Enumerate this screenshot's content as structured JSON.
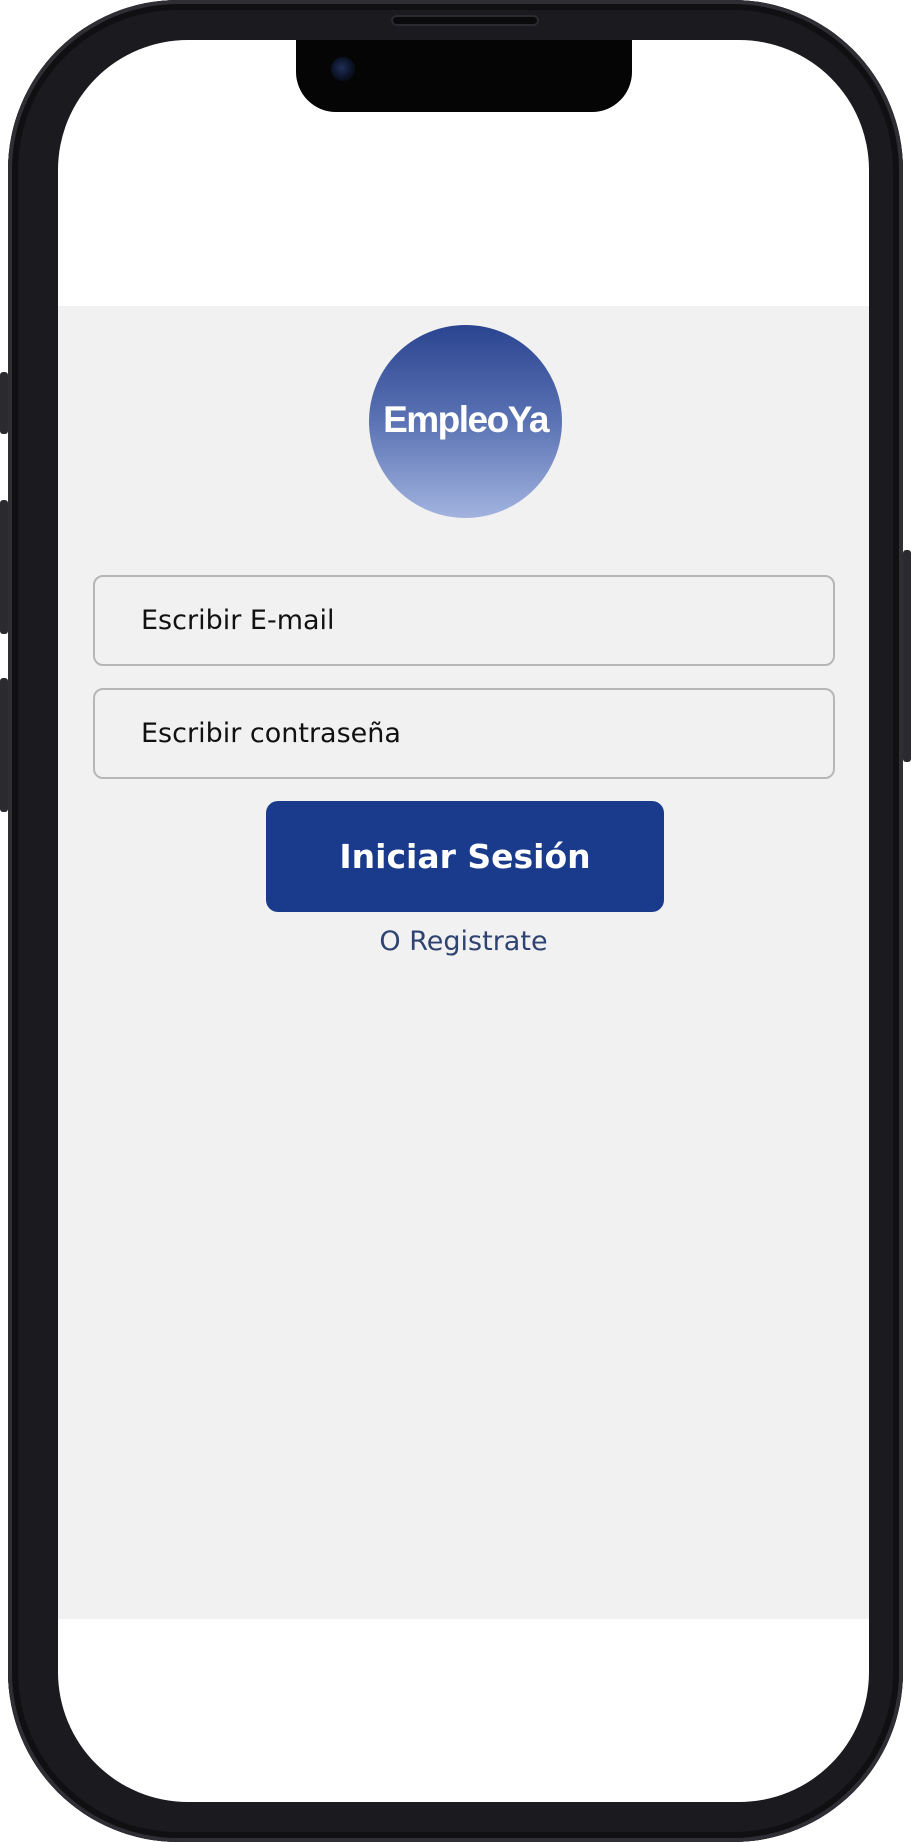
{
  "app": {
    "logo_text": "EmpleoYa"
  },
  "login_form": {
    "email_placeholder": "Escribir E-mail",
    "password_placeholder": "Escribir contraseña",
    "submit_label": "Iniciar Sesión",
    "register_link": "O Registrate"
  },
  "colors": {
    "primary_button": "#1a3b8c",
    "background": "#f1f1f1",
    "link": "#2f4372"
  },
  "icons": {
    "camera": "front-camera-icon"
  }
}
